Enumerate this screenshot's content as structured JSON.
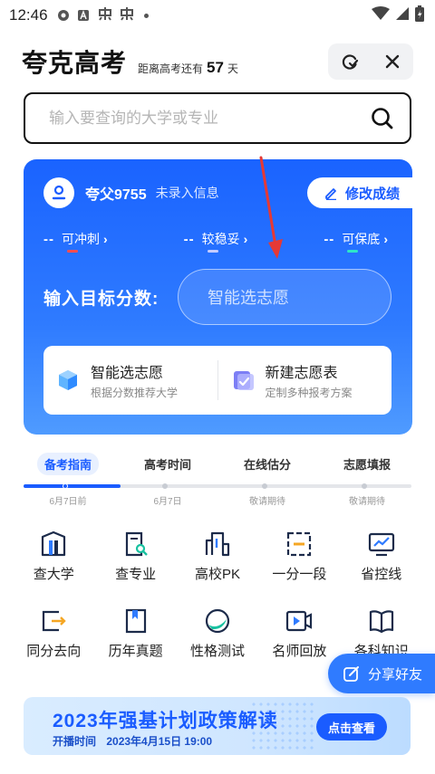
{
  "status_bar": {
    "time": "12:46",
    "icons": [
      "circle-notification-icon",
      "a-notification-icon",
      "app-notification-icon",
      "app-notification-icon",
      "dot-icon",
      "wifi-icon",
      "signal-icon",
      "battery-icon"
    ]
  },
  "header": {
    "title": "夸克高考",
    "countdown_prefix": "距离高考还有",
    "countdown_days": "57",
    "countdown_suffix": "天"
  },
  "search": {
    "placeholder": "输入要查询的大学或专业"
  },
  "card": {
    "user_name": "夸父9755",
    "user_status": "未录入信息",
    "edit_label": "修改成绩",
    "levels": [
      {
        "dash": "--",
        "label": "可冲刺",
        "color": "#ff4d4f"
      },
      {
        "dash": "--",
        "label": "较稳妥",
        "color": "#b9c4ff"
      },
      {
        "dash": "--",
        "label": "可保底",
        "color": "#2ee6c8"
      }
    ],
    "target_label": "输入目标分数:",
    "target_placeholder": "智能选志愿",
    "features": [
      {
        "title": "智能选志愿",
        "desc": "根据分数推荐大学"
      },
      {
        "title": "新建志愿表",
        "desc": "定制多种报考方案"
      }
    ]
  },
  "timeline": {
    "tabs": [
      "备考指南",
      "高考时间",
      "在线估分",
      "志愿填报"
    ],
    "dates": [
      "6月7日前",
      "6月7日",
      "敬请期待",
      "敬请期待"
    ],
    "progress": 0.25
  },
  "grid": [
    {
      "label": "查大学",
      "icon": "university-icon"
    },
    {
      "label": "查专业",
      "icon": "major-search-icon"
    },
    {
      "label": "高校PK",
      "icon": "college-pk-icon"
    },
    {
      "label": "一分一段",
      "icon": "score-segment-icon"
    },
    {
      "label": "省控线",
      "icon": "province-line-icon"
    },
    {
      "label": "同分去向",
      "icon": "same-score-icon"
    },
    {
      "label": "历年真题",
      "icon": "past-exams-icon"
    },
    {
      "label": "性格测试",
      "icon": "personality-test-icon"
    },
    {
      "label": "名师回放",
      "icon": "video-replay-icon"
    },
    {
      "label": "各科知识",
      "icon": "subject-knowledge-icon"
    }
  ],
  "share": {
    "label": "分享好友"
  },
  "banner": {
    "title": "2023年强基计划政策解读",
    "time_label": "开播时间",
    "time_value": "2023年4月15日 19:00",
    "button": "点击查看"
  },
  "colors": {
    "accent": "#1a5cff",
    "card_top": "#1a63ff",
    "card_bottom": "#4f9bff",
    "annotation_arrow": "#e53935"
  }
}
